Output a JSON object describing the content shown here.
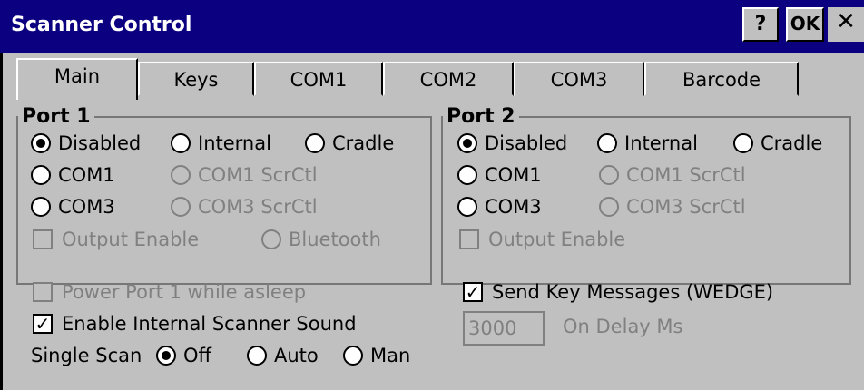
{
  "window": {
    "title": "Scanner Control",
    "help_label": "?",
    "ok_label": "OK",
    "close_label": "✕"
  },
  "tabs": [
    "Main",
    "Keys",
    "COM1",
    "COM2",
    "COM3",
    "Barcode"
  ],
  "active_tab": "Main",
  "port1": {
    "legend": "Port 1",
    "opt_disabled": "Disabled",
    "opt_internal": "Internal",
    "opt_cradle": "Cradle",
    "opt_com1": "COM1",
    "opt_com1_scrctl": "COM1 ScrCtl",
    "opt_com3": "COM3",
    "opt_com3_scrctl": "COM3 ScrCtl",
    "output_enable": "Output Enable",
    "opt_bluetooth": "Bluetooth",
    "selected": "Disabled"
  },
  "port2": {
    "legend": "Port 2",
    "opt_disabled": "Disabled",
    "opt_internal": "Internal",
    "opt_cradle": "Cradle",
    "opt_com1": "COM1",
    "opt_com1_scrctl": "COM1 ScrCtl",
    "opt_com3": "COM3",
    "opt_com3_scrctl": "COM3 ScrCtl",
    "output_enable": "Output Enable",
    "selected": "Disabled"
  },
  "options": {
    "power_port1": "Power Port 1 while asleep",
    "power_port1_checked": false,
    "enable_sound": "Enable Internal Scanner Sound",
    "enable_sound_checked": true,
    "single_scan_label": "Single Scan",
    "single_off": "Off",
    "single_auto": "Auto",
    "single_man": "Man",
    "single_selected": "Off",
    "send_key": "Send Key Messages (WEDGE)",
    "send_key_checked": true,
    "on_delay_value": "3000",
    "on_delay_label": "On Delay Ms"
  },
  "check_mark": "✓"
}
